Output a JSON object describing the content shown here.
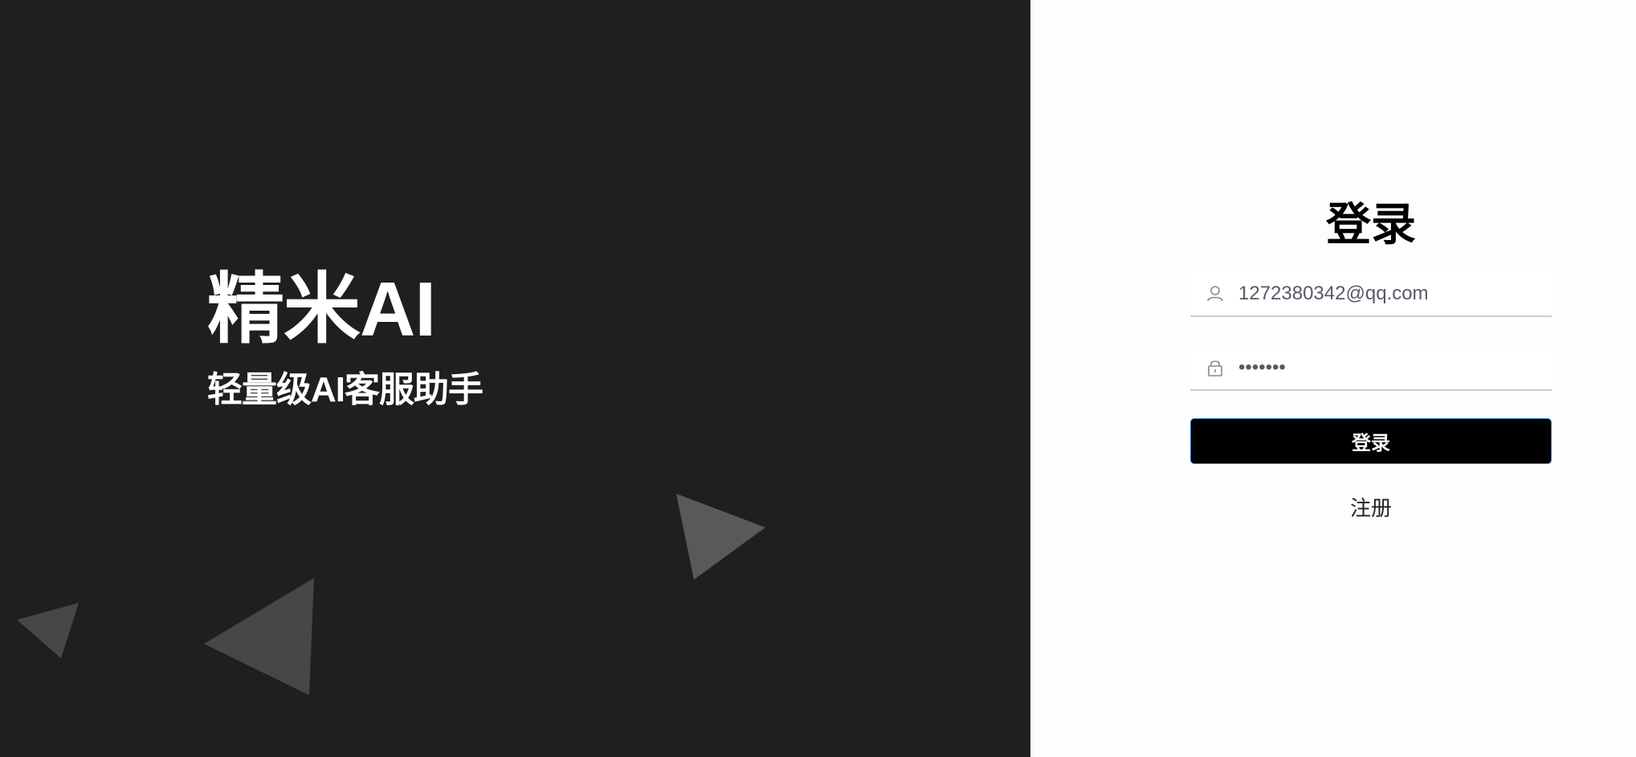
{
  "brand": {
    "title": "精米AI",
    "subtitle": "轻量级AI客服助手"
  },
  "login_form": {
    "title": "登录",
    "username": {
      "value": "1272380342@qq.com",
      "icon": "user-icon"
    },
    "password": {
      "value": "•••••••",
      "icon": "lock-icon"
    },
    "submit_label": "登录",
    "register_label": "注册"
  },
  "colors": {
    "left_background": "#1f1f1f",
    "right_background": "#fdfdfd",
    "button_background": "#000000",
    "triangle": "#555555"
  }
}
